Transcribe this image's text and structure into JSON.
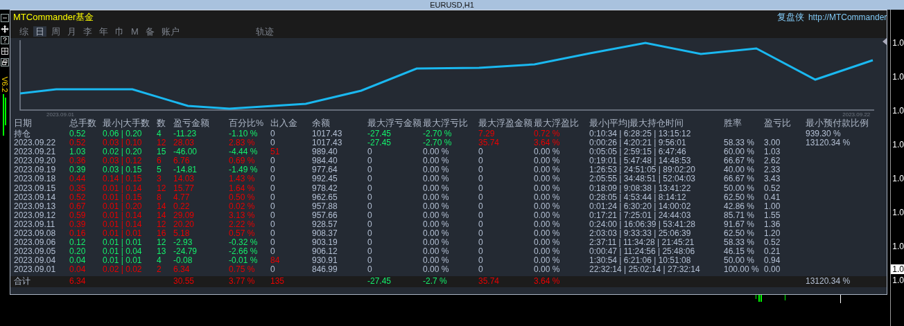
{
  "window": {
    "title": "EURUSD,H1"
  },
  "side_strip": {
    "version": "V6.2"
  },
  "panel": {
    "title": "MTCommander基金",
    "brand": "复盘侠",
    "link": "http://MTCommander"
  },
  "tabs": [
    {
      "label": "综",
      "selected": false
    },
    {
      "label": "日",
      "selected": true
    },
    {
      "label": "周",
      "selected": false
    },
    {
      "label": "月",
      "selected": false
    },
    {
      "label": "李",
      "selected": false
    },
    {
      "label": "年",
      "selected": false
    },
    {
      "label": "巾",
      "selected": false
    },
    {
      "label": "M",
      "selected": false
    },
    {
      "label": "备",
      "selected": false
    },
    {
      "label": "账户",
      "selected": false
    }
  ],
  "trace_button": "轨迹",
  "chart": {
    "start_label": "2023.09.01",
    "end_label": "2023.09.22"
  },
  "table": {
    "columns": [
      "日期",
      "总手数",
      "最小|大手数",
      "数",
      "盈亏金额",
      "百分比%",
      "出入金",
      "余额",
      "最大浮亏金额",
      "最大浮亏比",
      "最大浮盈金额",
      "最大浮盈比",
      "最小|平均|最大持仓时间",
      "胜率",
      "盈亏比",
      "最小预付款比例"
    ],
    "rows": [
      {
        "cells": [
          "持仓",
          {
            "text": "0.52",
            "color": "#14f06c"
          },
          {
            "text": "0.06 | 0.20",
            "color": "#14f06c"
          },
          {
            "text": "4",
            "color": "#14f06c"
          },
          {
            "text": "-11.23",
            "color": "#14f06c"
          },
          {
            "text": "-1.10 %",
            "color": "#14f06c"
          },
          "0",
          "1017.43",
          {
            "text": "-27.45",
            "color": "#14f06c"
          },
          {
            "text": "-2.70 %",
            "color": "#14f06c"
          },
          {
            "text": "7.29",
            "color": "#e80000"
          },
          {
            "text": "0.72 %",
            "color": "#e80000"
          },
          "0:10:34 | 6:28:25 | 13:15:12",
          null,
          null,
          "939.30 %"
        ]
      },
      {
        "cells": [
          "2023.09.22",
          {
            "text": "0.52",
            "color": "#e80000"
          },
          {
            "text": "0.03 | 0.10",
            "color": "#e80000"
          },
          {
            "text": "12",
            "color": "#e80000"
          },
          {
            "text": "28.03",
            "color": "#e80000"
          },
          {
            "text": "2.83 %",
            "color": "#e80000"
          },
          "0",
          "1017.43",
          {
            "text": "-27.45",
            "color": "#14f06c"
          },
          {
            "text": "-2.70 %",
            "color": "#14f06c"
          },
          {
            "text": "35.74",
            "color": "#e80000"
          },
          {
            "text": "3.64 %",
            "color": "#e80000"
          },
          "0:00:26 | 4:20:21 | 9:56:01",
          "58.33 %",
          "3.00",
          "13120.34 %"
        ]
      },
      {
        "cells": [
          "2023.09.21",
          {
            "text": "1.03",
            "color": "#14f06c"
          },
          {
            "text": "0.02 | 0.20",
            "color": "#14f06c"
          },
          {
            "text": "15",
            "color": "#14f06c"
          },
          {
            "text": "-46.00",
            "color": "#14f06c"
          },
          {
            "text": "-4.44 %",
            "color": "#14f06c"
          },
          {
            "text": "51",
            "color": "#e80000"
          },
          "989.40",
          "0",
          "0.00 %",
          "0",
          "0.00 %",
          "0:05:05 | 2:59:15 | 6:47:46",
          "60.00 %",
          "1.03",
          null
        ]
      },
      {
        "cells": [
          "2023.09.20",
          {
            "text": "0.36",
            "color": "#e80000"
          },
          {
            "text": "0.03 | 0.12",
            "color": "#e80000"
          },
          {
            "text": "6",
            "color": "#e80000"
          },
          {
            "text": "6.76",
            "color": "#e80000"
          },
          {
            "text": "0.69 %",
            "color": "#e80000"
          },
          "0",
          "984.40",
          "0",
          "0.00 %",
          "0",
          "0.00 %",
          "0:19:01 | 5:47:48 | 14:48:53",
          "66.67 %",
          "2.62",
          null
        ]
      },
      {
        "cells": [
          "2023.09.19",
          {
            "text": "0.39",
            "color": "#14f06c"
          },
          {
            "text": "0.03 | 0.15",
            "color": "#14f06c"
          },
          {
            "text": "5",
            "color": "#14f06c"
          },
          {
            "text": "-14.81",
            "color": "#14f06c"
          },
          {
            "text": "-1.49 %",
            "color": "#14f06c"
          },
          "0",
          "977.64",
          "0",
          "0.00 %",
          "0",
          "0.00 %",
          "1:26:53 | 24:51:05 | 89:02:20",
          "40.00 %",
          "2.33",
          null
        ]
      },
      {
        "cells": [
          "2023.09.18",
          {
            "text": "0.44",
            "color": "#e80000"
          },
          {
            "text": "0.14 | 0.15",
            "color": "#e80000"
          },
          {
            "text": "3",
            "color": "#e80000"
          },
          {
            "text": "14.03",
            "color": "#e80000"
          },
          {
            "text": "1.43 %",
            "color": "#e80000"
          },
          "0",
          "992.45",
          "0",
          "0.00 %",
          "0",
          "0.00 %",
          "2:05:55 | 34:48:51 | 52:04:03",
          "66.67 %",
          "3.43",
          null
        ]
      },
      {
        "cells": [
          "2023.09.15",
          {
            "text": "0.35",
            "color": "#e80000"
          },
          {
            "text": "0.01 | 0.14",
            "color": "#e80000"
          },
          {
            "text": "12",
            "color": "#e80000"
          },
          {
            "text": "15.77",
            "color": "#e80000"
          },
          {
            "text": "1.64 %",
            "color": "#e80000"
          },
          "0",
          "978.42",
          "0",
          "0.00 %",
          "0",
          "0.00 %",
          "0:18:09 | 9:08:38 | 13:41:22",
          "50.00 %",
          "0.52",
          null
        ]
      },
      {
        "cells": [
          "2023.09.14",
          {
            "text": "0.52",
            "color": "#e80000"
          },
          {
            "text": "0.01 | 0.15",
            "color": "#e80000"
          },
          {
            "text": "8",
            "color": "#e80000"
          },
          {
            "text": "4.77",
            "color": "#e80000"
          },
          {
            "text": "0.50 %",
            "color": "#e80000"
          },
          "0",
          "962.65",
          "0",
          "0.00 %",
          "0",
          "0.00 %",
          "0:28:05 | 4:53:44 | 8:14:12",
          "62.50 %",
          "0.41",
          null
        ]
      },
      {
        "cells": [
          "2023.09.13",
          {
            "text": "0.67",
            "color": "#e80000"
          },
          {
            "text": "0.01 | 0.20",
            "color": "#e80000"
          },
          {
            "text": "14",
            "color": "#e80000"
          },
          {
            "text": "0.22",
            "color": "#e80000"
          },
          {
            "text": "0.02 %",
            "color": "#e80000"
          },
          "0",
          "957.88",
          "0",
          "0.00 %",
          "0",
          "0.00 %",
          "0:01:24 | 6:30:20 | 14:00:02",
          "42.86 %",
          "1.00",
          null
        ]
      },
      {
        "cells": [
          "2023.09.12",
          {
            "text": "0.59",
            "color": "#e80000"
          },
          {
            "text": "0.01 | 0.14",
            "color": "#e80000"
          },
          {
            "text": "14",
            "color": "#e80000"
          },
          {
            "text": "29.09",
            "color": "#e80000"
          },
          {
            "text": "3.13 %",
            "color": "#e80000"
          },
          "0",
          "957.66",
          "0",
          "0.00 %",
          "0",
          "0.00 %",
          "0:17:21 | 7:25:01 | 24:44:03",
          "85.71 %",
          "1.55",
          null
        ]
      },
      {
        "cells": [
          "2023.09.11",
          {
            "text": "0.39",
            "color": "#e80000"
          },
          {
            "text": "0.01 | 0.14",
            "color": "#e80000"
          },
          {
            "text": "12",
            "color": "#e80000"
          },
          {
            "text": "20.20",
            "color": "#e80000"
          },
          {
            "text": "2.22 %",
            "color": "#e80000"
          },
          "0",
          "928.57",
          "0",
          "0.00 %",
          "0",
          "0.00 %",
          "0:24:00 | 16:06:39 | 53:41:28",
          "91.67 %",
          "1.36",
          null
        ]
      },
      {
        "cells": [
          "2023.09.08",
          {
            "text": "0.16",
            "color": "#e80000"
          },
          {
            "text": "0.01 | 0.01",
            "color": "#e80000"
          },
          {
            "text": "16",
            "color": "#e80000"
          },
          {
            "text": "5.18",
            "color": "#e80000"
          },
          {
            "text": "0.57 %",
            "color": "#e80000"
          },
          "0",
          "908.37",
          "0",
          "0.00 %",
          "0",
          "0.00 %",
          "2:03:03 | 9:33:33 | 25:06:39",
          "62.50 %",
          "1.20",
          null
        ]
      },
      {
        "cells": [
          "2023.09.06",
          {
            "text": "0.12",
            "color": "#14f06c"
          },
          {
            "text": "0.01 | 0.01",
            "color": "#14f06c"
          },
          {
            "text": "12",
            "color": "#14f06c"
          },
          {
            "text": "-2.93",
            "color": "#14f06c"
          },
          {
            "text": "-0.32 %",
            "color": "#14f06c"
          },
          "0",
          "903.19",
          "0",
          "0.00 %",
          "0",
          "0.00 %",
          "2:37:11 | 11:34:28 | 21:45:21",
          "58.33 %",
          "0.52",
          null
        ]
      },
      {
        "cells": [
          "2023.09.05",
          {
            "text": "0.20",
            "color": "#14f06c"
          },
          {
            "text": "0.01 | 0.04",
            "color": "#14f06c"
          },
          {
            "text": "13",
            "color": "#14f06c"
          },
          {
            "text": "-24.79",
            "color": "#14f06c"
          },
          {
            "text": "-2.66 %",
            "color": "#14f06c"
          },
          "0",
          "906.12",
          "0",
          "0.00 %",
          "0",
          "0.00 %",
          "0:00:47 | 11:24:56 | 25:48:06",
          "46.15 %",
          "0.21",
          null
        ]
      },
      {
        "cells": [
          "2023.09.04",
          {
            "text": "0.04",
            "color": "#14f06c"
          },
          {
            "text": "0.01 | 0.01",
            "color": "#14f06c"
          },
          {
            "text": "4",
            "color": "#14f06c"
          },
          {
            "text": "-0.08",
            "color": "#14f06c"
          },
          {
            "text": "-0.01 %",
            "color": "#14f06c"
          },
          {
            "text": "84",
            "color": "#e80000"
          },
          "930.91",
          "0",
          "0.00 %",
          "0",
          "0.00 %",
          "1:30:54 | 6:21:06 | 10:51:08",
          "50.00 %",
          "0.94",
          null
        ]
      },
      {
        "cells": [
          "2023.09.01",
          {
            "text": "0.04",
            "color": "#e80000"
          },
          {
            "text": "0.02 | 0.02",
            "color": "#e80000"
          },
          {
            "text": "2",
            "color": "#e80000"
          },
          {
            "text": "6.34",
            "color": "#e80000"
          },
          {
            "text": "0.75 %",
            "color": "#e80000"
          },
          "0",
          "846.99",
          "0",
          "0.00 %",
          "0",
          "0.00 %",
          "22:32:14 | 25:02:14 | 27:32:14",
          "100.00 %",
          "0.00",
          null
        ]
      }
    ],
    "total": {
      "cells": [
        "合计",
        {
          "text": "6.34",
          "color": "#e80000"
        },
        null,
        null,
        {
          "text": "30.55",
          "color": "#e80000"
        },
        {
          "text": "3.77 %",
          "color": "#e80000"
        },
        {
          "text": "135",
          "color": "#e80000"
        },
        null,
        {
          "text": "-27.45",
          "color": "#14f06c"
        },
        {
          "text": "-2.7 %",
          "color": "#14f06c"
        },
        {
          "text": "35.74",
          "color": "#e80000"
        },
        {
          "text": "3.64 %",
          "color": "#e80000"
        },
        null,
        null,
        null,
        "13120.34 %"
      ]
    }
  },
  "price_axis": [
    {
      "label": "1.0",
      "current": false
    },
    {
      "label": "1.0",
      "current": false
    },
    {
      "label": "1.0",
      "current": false
    },
    {
      "label": "1.0",
      "current": false
    },
    {
      "label": "1.0",
      "current": false
    },
    {
      "label": "1.0",
      "current": false
    },
    {
      "label": "1.0",
      "current": false
    },
    {
      "label": "1.0",
      "current": true
    },
    {
      "label": "1.0",
      "current": false
    }
  ]
}
